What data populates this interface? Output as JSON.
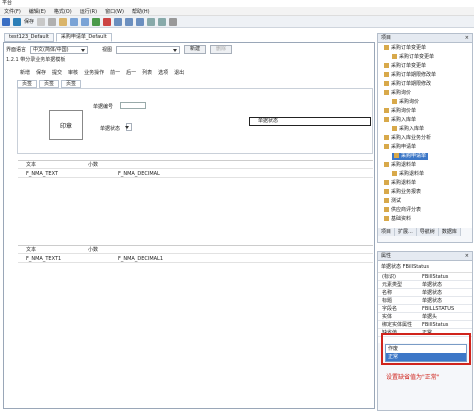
{
  "app": {
    "title": "平台"
  },
  "menu": [
    "文件(F)",
    "编辑(E)",
    "格式(O)",
    "运行(R)",
    "窗口(W)",
    "帮助(H)"
  ],
  "toolbar": {
    "save_label": "保存"
  },
  "doc_tabs": [
    "test123_Default",
    "采购申请单_Default"
  ],
  "lang": {
    "label": "界面语言",
    "value": "中文(简体/中国)",
    "view_label": "视图",
    "new_btn": "新建",
    "delete_btn": "删除"
  },
  "template": {
    "title": "1.2.1 带分录业务单据模板"
  },
  "inner_toolbar": [
    "新增",
    "保存",
    "提交",
    "审核",
    "业务操作",
    "前一",
    "后一",
    "列表",
    "选项",
    "退出"
  ],
  "page_tabs": [
    "页签",
    "页签",
    "页签"
  ],
  "form": {
    "stamp": "印章",
    "bill_no": "单据编号",
    "doc_status": "单据状态",
    "doc_status_field": "单据状态"
  },
  "grid1": {
    "headers": [
      "文本",
      "小数"
    ],
    "rows": [
      [
        "F_NMA_TEXT",
        "F_NMA_DECIMAL"
      ]
    ]
  },
  "grid2": {
    "headers": [
      "文本",
      "小数"
    ],
    "rows": [
      [
        "F_NMA_TEXT1",
        "F_NMA_DECIMAL1"
      ]
    ]
  },
  "project_panel": {
    "title": "项目",
    "items": [
      {
        "label": "采购订单变更单",
        "level": 0
      },
      {
        "label": "采购订单变更单",
        "level": 1
      },
      {
        "label": "采购订单变更单",
        "level": 0
      },
      {
        "label": "采购订单期限修改单",
        "level": 0
      },
      {
        "label": "采购订单期限修改",
        "level": 0
      },
      {
        "label": "采购询价",
        "level": 0
      },
      {
        "label": "采购询价",
        "level": 1
      },
      {
        "label": "采购询价单",
        "level": 0
      },
      {
        "label": "采购入库单",
        "level": 0
      },
      {
        "label": "采购入库单",
        "level": 1
      },
      {
        "label": "采购入库业务分析",
        "level": 0
      },
      {
        "label": "采购申请单",
        "level": 0
      },
      {
        "label": "采购申请单",
        "level": 1,
        "selected": true
      },
      {
        "label": "采购退料单",
        "level": 0
      },
      {
        "label": "采购退料单",
        "level": 1
      },
      {
        "label": "采购退料单",
        "level": 0
      },
      {
        "label": "采购业务报表",
        "level": 0
      },
      {
        "label": "测试",
        "level": 0
      },
      {
        "label": "供应商评分表",
        "level": 0
      },
      {
        "label": "基础资料",
        "level": 0
      }
    ],
    "bottom_tabs": [
      "项目",
      "扩展...",
      "导航树",
      "数据库"
    ]
  },
  "properties_panel": {
    "title": "属性",
    "subject": "单据状态 FBillStatus",
    "rows": [
      {
        "k": "(标识)",
        "v": "FBillStatus"
      },
      {
        "k": "元素类型",
        "v": "单据状态"
      },
      {
        "k": "名称",
        "v": "单据状态"
      },
      {
        "k": "标题",
        "v": "单据状态"
      },
      {
        "k": "字段名",
        "v": "FBILLSTATUS"
      },
      {
        "k": "实体",
        "v": "单据头"
      },
      {
        "k": "绑定实体属性",
        "v": "FBillStatus"
      },
      {
        "k": "缺省值",
        "v": "正常"
      }
    ],
    "dropdown_options": [
      "作废",
      "正常"
    ],
    "note": "设置缺省值为\"正常\""
  }
}
